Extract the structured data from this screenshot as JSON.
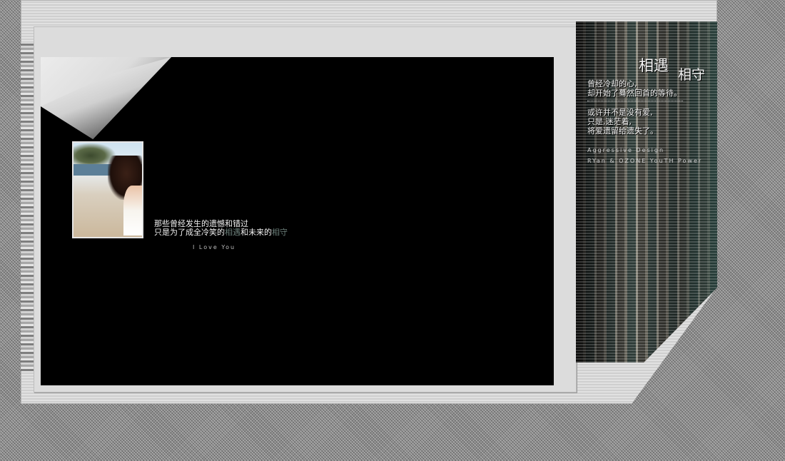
{
  "left_photo_caption": {
    "line1": "那些曾经发生的遗憾和错过",
    "line2_prefix": "只是为了成全冷笑的",
    "line2_hl1": "相遇",
    "line2_mid": "和未来的",
    "line2_hl2": "相守"
  },
  "love_text": "I Love You",
  "right_panel": {
    "title1": "相遇",
    "title2": "相守",
    "line1": "曾经冷却的心,",
    "line2": "却开始了蓦然回首的等待。",
    "line3": "或许并不是没有爱,",
    "line4": "只是,迷茫着,",
    "line5": "将爱遗留给遗失了。",
    "credit1": "Aggressive Design",
    "credit2": "RYan & OZONE YouTH Power"
  }
}
